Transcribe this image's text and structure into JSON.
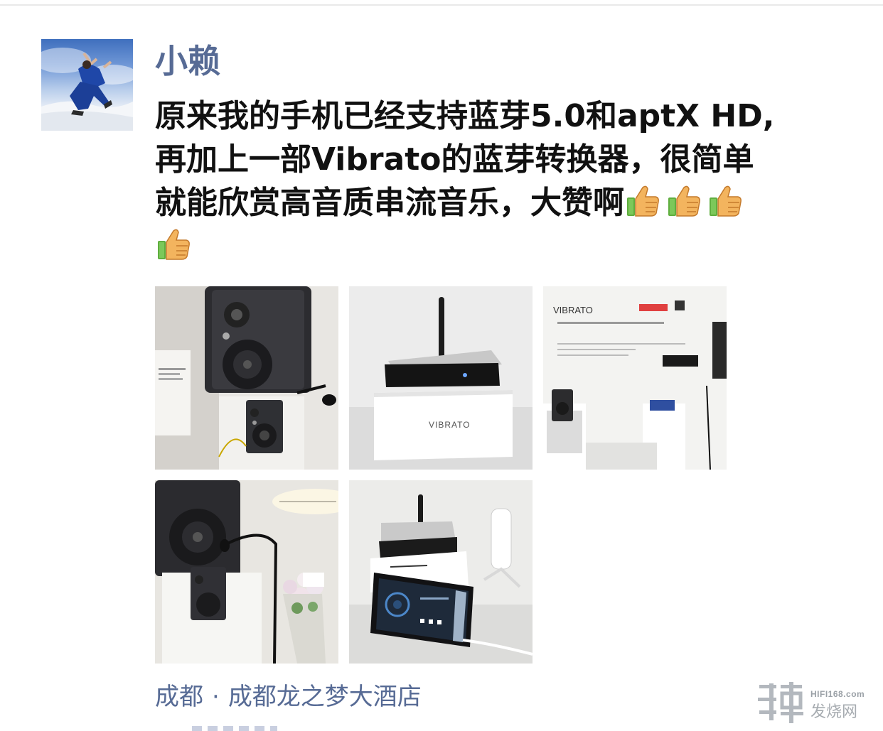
{
  "post": {
    "username": "小赖",
    "lines": [
      "原来我的手机已经支持蓝芽5.0和aptX HD,",
      "再加上一部Vibrato的蓝芽转换器，很简单",
      "就能欣赏高音质串流音乐，大赞啊"
    ],
    "emoji": "thumbs-up-icon",
    "photo_labels": {
      "p2_brand": "VIBRATO",
      "p3_brand": "VIBRATO"
    },
    "location": {
      "city": "成都",
      "separator": "·",
      "venue": "成都龙之梦大酒店"
    }
  },
  "watermark": {
    "url": "HIFI168.com",
    "name": "发烧网"
  },
  "colors": {
    "link": "#576b95",
    "text": "#111111"
  }
}
